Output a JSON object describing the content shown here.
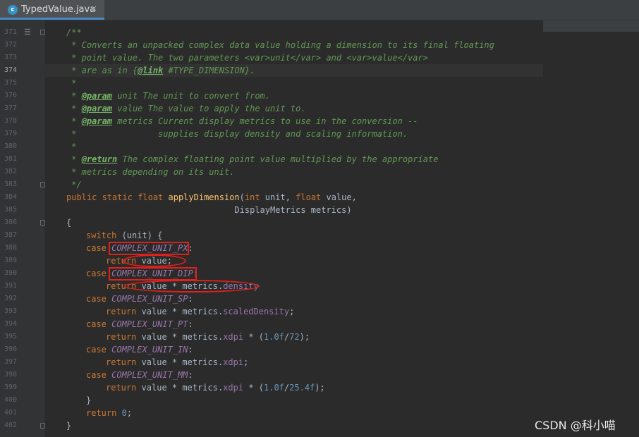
{
  "tab": {
    "title": "TypedValue.java",
    "icon_letter": "c",
    "close": "×"
  },
  "watermark": "CSDN @科小喵",
  "lines": [
    {
      "n": "371"
    },
    {
      "n": "372"
    },
    {
      "n": "373"
    },
    {
      "n": "374"
    },
    {
      "n": "375"
    },
    {
      "n": "376"
    },
    {
      "n": "377"
    },
    {
      "n": "378"
    },
    {
      "n": "379"
    },
    {
      "n": "380"
    },
    {
      "n": "381"
    },
    {
      "n": "382"
    },
    {
      "n": "383"
    },
    {
      "n": "384"
    },
    {
      "n": "385"
    },
    {
      "n": "386"
    },
    {
      "n": "387"
    },
    {
      "n": "388"
    },
    {
      "n": "389"
    },
    {
      "n": "390"
    },
    {
      "n": "391"
    },
    {
      "n": "392"
    },
    {
      "n": "393"
    },
    {
      "n": "394"
    },
    {
      "n": "395"
    },
    {
      "n": "396"
    },
    {
      "n": "397"
    },
    {
      "n": "398"
    },
    {
      "n": "399"
    },
    {
      "n": "400"
    },
    {
      "n": "401"
    },
    {
      "n": "402"
    }
  ],
  "code": {
    "l371": "/**",
    "l372": " * Converts an unpacked complex data value holding a dimension to its final floating",
    "l373": " * point value. The two parameters <var>unit</var> and <var>value</var>",
    "l374a": " * are as in {",
    "l374b": "@link",
    "l374c": " #TYPE_DIMENSION}.",
    "l375": " *",
    "l376a": " * ",
    "l376b": "@param",
    "l376c": " unit The unit to convert from.",
    "l377a": " * ",
    "l377b": "@param",
    "l377c": " value The value to apply the unit to.",
    "l378a": " * ",
    "l378b": "@param",
    "l378c": " metrics Current display metrics to use in the conversion --",
    "l379": " *                supplies display density and scaling information.",
    "l380": " *",
    "l381a": " * ",
    "l381b": "@return",
    "l381c": " The complex floating point value multiplied by the appropriate",
    "l382": " * metrics depending on its unit.",
    "l383": " */",
    "kw_public_static_float": "public static float ",
    "fn_applyDimension": "applyDimension",
    "sig_open": "(",
    "kw_int": "int",
    "p_unit": " unit, ",
    "kw_float": "float",
    "p_value": " value,",
    "l385": "                                 DisplayMetrics metrics)",
    "brace_open": "{",
    "kw_switch": "switch",
    "switch_rest": " (unit) {",
    "kw_case": "case ",
    "c_px": "COMPLEX_UNIT_PX",
    "c_dip": "COMPLEX_UNIT_DIP",
    "c_sp": "COMPLEX_UNIT_SP",
    "c_pt": "COMPLEX_UNIT_PT",
    "c_in": "COMPLEX_UNIT_IN",
    "c_mm": "COMPLEX_UNIT_MM",
    "colon": ":",
    "kw_return": "return",
    "r_value": " value;",
    "r_value_mul": " value * metrics.",
    "f_density": "density",
    "f_scaledDensity": "scaledDensity",
    "f_xdpi": "xdpi",
    "semi": ";",
    "mul_open": " * (",
    "n_1_0f": "1.0f",
    "slash72": "/",
    "n_72": "72",
    "n_25_4f": "25.4f",
    "close_semi": ");",
    "brace_close_inner": "}",
    "r_zero_num": "0",
    "brace_close": "}"
  }
}
